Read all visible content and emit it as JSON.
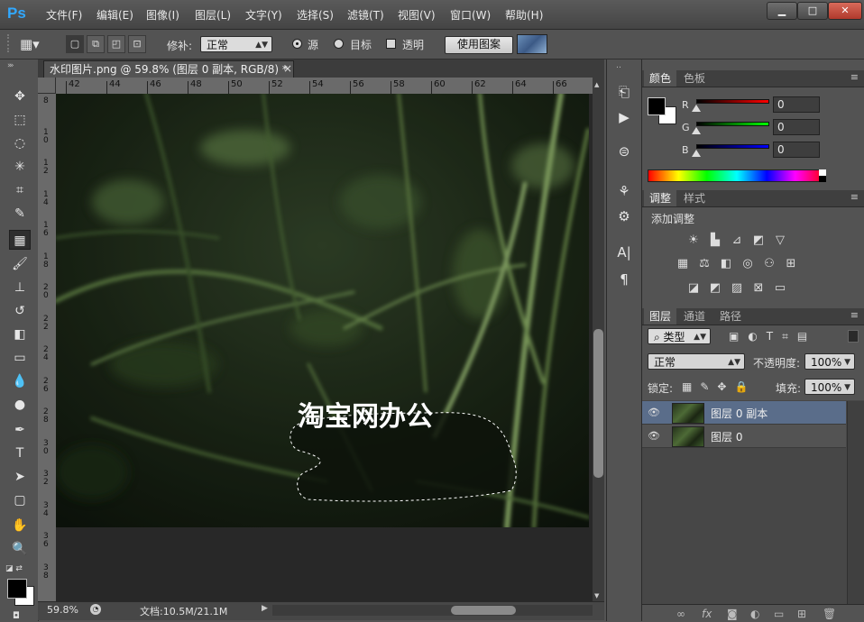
{
  "app": {
    "logo": "Ps"
  },
  "menu": [
    "文件(F)",
    "编辑(E)",
    "图像(I)",
    "图层(L)",
    "文字(Y)",
    "选择(S)",
    "滤镜(T)",
    "视图(V)",
    "窗口(W)",
    "帮助(H)"
  ],
  "window_controls": {
    "minimize": "▁",
    "maximize": "□",
    "close": "✕"
  },
  "options": {
    "patch_label": "修补:",
    "patch_mode": "正常",
    "source_label": "源",
    "target_label": "目标",
    "transparent_label": "透明",
    "use_pattern": "使用图案"
  },
  "document": {
    "tab_title": "水印图片.png @ 59.8% (图层 0 副本, RGB/8) *",
    "tab_close": "×",
    "ruler_h": [
      "42",
      "44",
      "46",
      "48",
      "50",
      "52",
      "54",
      "56",
      "58",
      "60",
      "62",
      "64",
      "66"
    ],
    "ruler_v": [
      "8",
      "1 0",
      "1 2",
      "1 4",
      "1 6",
      "1 8",
      "2 0",
      "2 2",
      "2 4",
      "2 6",
      "2 8",
      "3 0",
      "3 2",
      "3 4",
      "3 6",
      "3 8"
    ],
    "watermark_text": "淘宝网办公",
    "zoom": "59.8%",
    "doc_info": "文档:10.5M/21.1M"
  },
  "color_panel": {
    "tabs": [
      "颜色",
      "色板"
    ],
    "r_label": "R",
    "g_label": "G",
    "b_label": "B",
    "r": "0",
    "g": "0",
    "b": "0"
  },
  "adjust_panel": {
    "tabs": [
      "调整",
      "样式"
    ],
    "title": "添加调整"
  },
  "layers_panel": {
    "tabs": [
      "图层",
      "通道",
      "路径"
    ],
    "filter": "类型",
    "blend_mode": "正常",
    "opacity_label": "不透明度:",
    "opacity": "100%",
    "lock_label": "锁定:",
    "fill_label": "填充:",
    "fill": "100%",
    "layers": [
      {
        "name": "图层 0 副本",
        "selected": true
      },
      {
        "name": "图层 0",
        "selected": false
      }
    ],
    "bottom_icons": [
      "∞",
      "fx",
      "◙",
      "◐",
      "▭",
      "⊞",
      "🗑"
    ]
  },
  "colors": {
    "selection_blue": "#5a6d8a",
    "ps_blue": "#31a8ff"
  }
}
